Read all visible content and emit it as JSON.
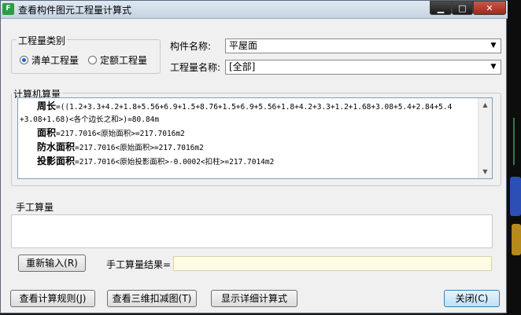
{
  "window": {
    "title": "查看构件图元工程量计算式",
    "icon": "app-icon",
    "icon_glyph": "F"
  },
  "window_controls": {
    "minimize": "▁",
    "maximize": "□",
    "close": "✕"
  },
  "quantity_type": {
    "legend": "工程量类别",
    "options": [
      {
        "label": "清单工程量",
        "selected": true
      },
      {
        "label": "定额工程量",
        "selected": false
      }
    ]
  },
  "component": {
    "label": "构件名称:",
    "value": "平屋面"
  },
  "quantity_name": {
    "label": "工程量名称:",
    "value": "[全部]"
  },
  "computer_calc": {
    "legend": "计算机算量",
    "lines": [
      {
        "name": "周长",
        "expr": "=((1.2+3.3+4.2+1.8+5.56+6.9+1.5+8.76+1.5+6.9+5.56+1.8+4.2+3.3+1.2+1.68+3.08+5.4+2.84+5.4"
      },
      {
        "name": "",
        "expr": "+3.08+1.68)<各个边长之和>)=80.84m"
      },
      {
        "name": "面积",
        "expr": "=217.7016<原始面积>=217.7016m2"
      },
      {
        "name": "防水面积",
        "expr": "=217.7016<原始面积>=217.7016m2"
      },
      {
        "name": "投影面积",
        "expr": "=217.7016<原始投影面积>-0.0002<扣柱>=217.7014m2"
      }
    ]
  },
  "manual_calc": {
    "legend": "手工算量",
    "reinput_button": "重新输入(R)",
    "result_label": "手工算量结果=",
    "result_value": ""
  },
  "footer": {
    "view_rules_button": "查看计算规则(J)",
    "view_3d_button": "查看三维扣减图(T)",
    "show_detail_button": "显示详细计算式",
    "close_button": "关闭(C)"
  },
  "colors": {
    "accent": "#1e5bd8",
    "result_bg": "#fffce6",
    "title_bar": "#c6d3e1"
  }
}
